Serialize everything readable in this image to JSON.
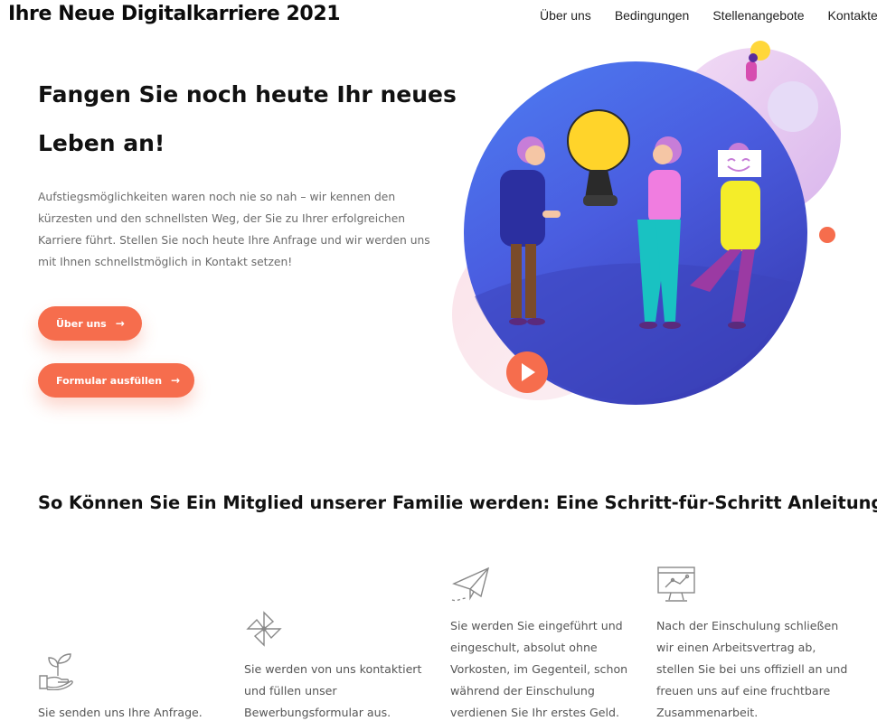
{
  "header": {
    "brand": "Ihre Neue Digitalkarriere 2021",
    "nav": [
      "Über uns",
      "Bedingungen",
      "Stellenangebote",
      "Kontakte"
    ]
  },
  "hero": {
    "title": "Fangen Sie noch heute Ihr neues Leben an!",
    "text": "Aufstiegsmöglichkeiten waren noch nie so nah – wir kennen den kürzesten und den schnellsten Weg, der Sie zu Ihrer erfolgreichen Karriere führt. Stellen Sie  noch heute Ihre Anfrage und wir werden uns mit Ihnen schnellstmöglich in Kontakt setzen!",
    "buttons": {
      "about": "Über uns",
      "form": "Formular ausfüllen",
      "arrow": "→"
    }
  },
  "steps": {
    "title": "So Können Sie Ein Mitglied unserer Familie werden: Eine Schritt-für-Schritt Anleitung.",
    "items": [
      {
        "icon": "hand-plant-icon",
        "text": "Sie senden uns Ihre Anfrage."
      },
      {
        "icon": "pinwheel-icon",
        "text": "Sie werden von uns kontaktiert und füllen unser Bewerbungsformular aus."
      },
      {
        "icon": "paper-plane-icon",
        "text": "Sie werden Sie eingeführt und eingeschult, absolut ohne Vorkosten, im Gegenteil, schon während der Einschulung verdienen Sie Ihr erstes Geld."
      },
      {
        "icon": "monitor-chart-icon",
        "text": "Nach der Einschulung schließen wir einen Arbeitsvertrag ab, stellen Sie bei uns offiziell an und freuen uns auf eine fruchtbare Zusammenarbeit."
      }
    ]
  },
  "colors": {
    "accent": "#f66d4d",
    "circle": "#4a5fe0",
    "text_muted": "#6b6b6b"
  }
}
